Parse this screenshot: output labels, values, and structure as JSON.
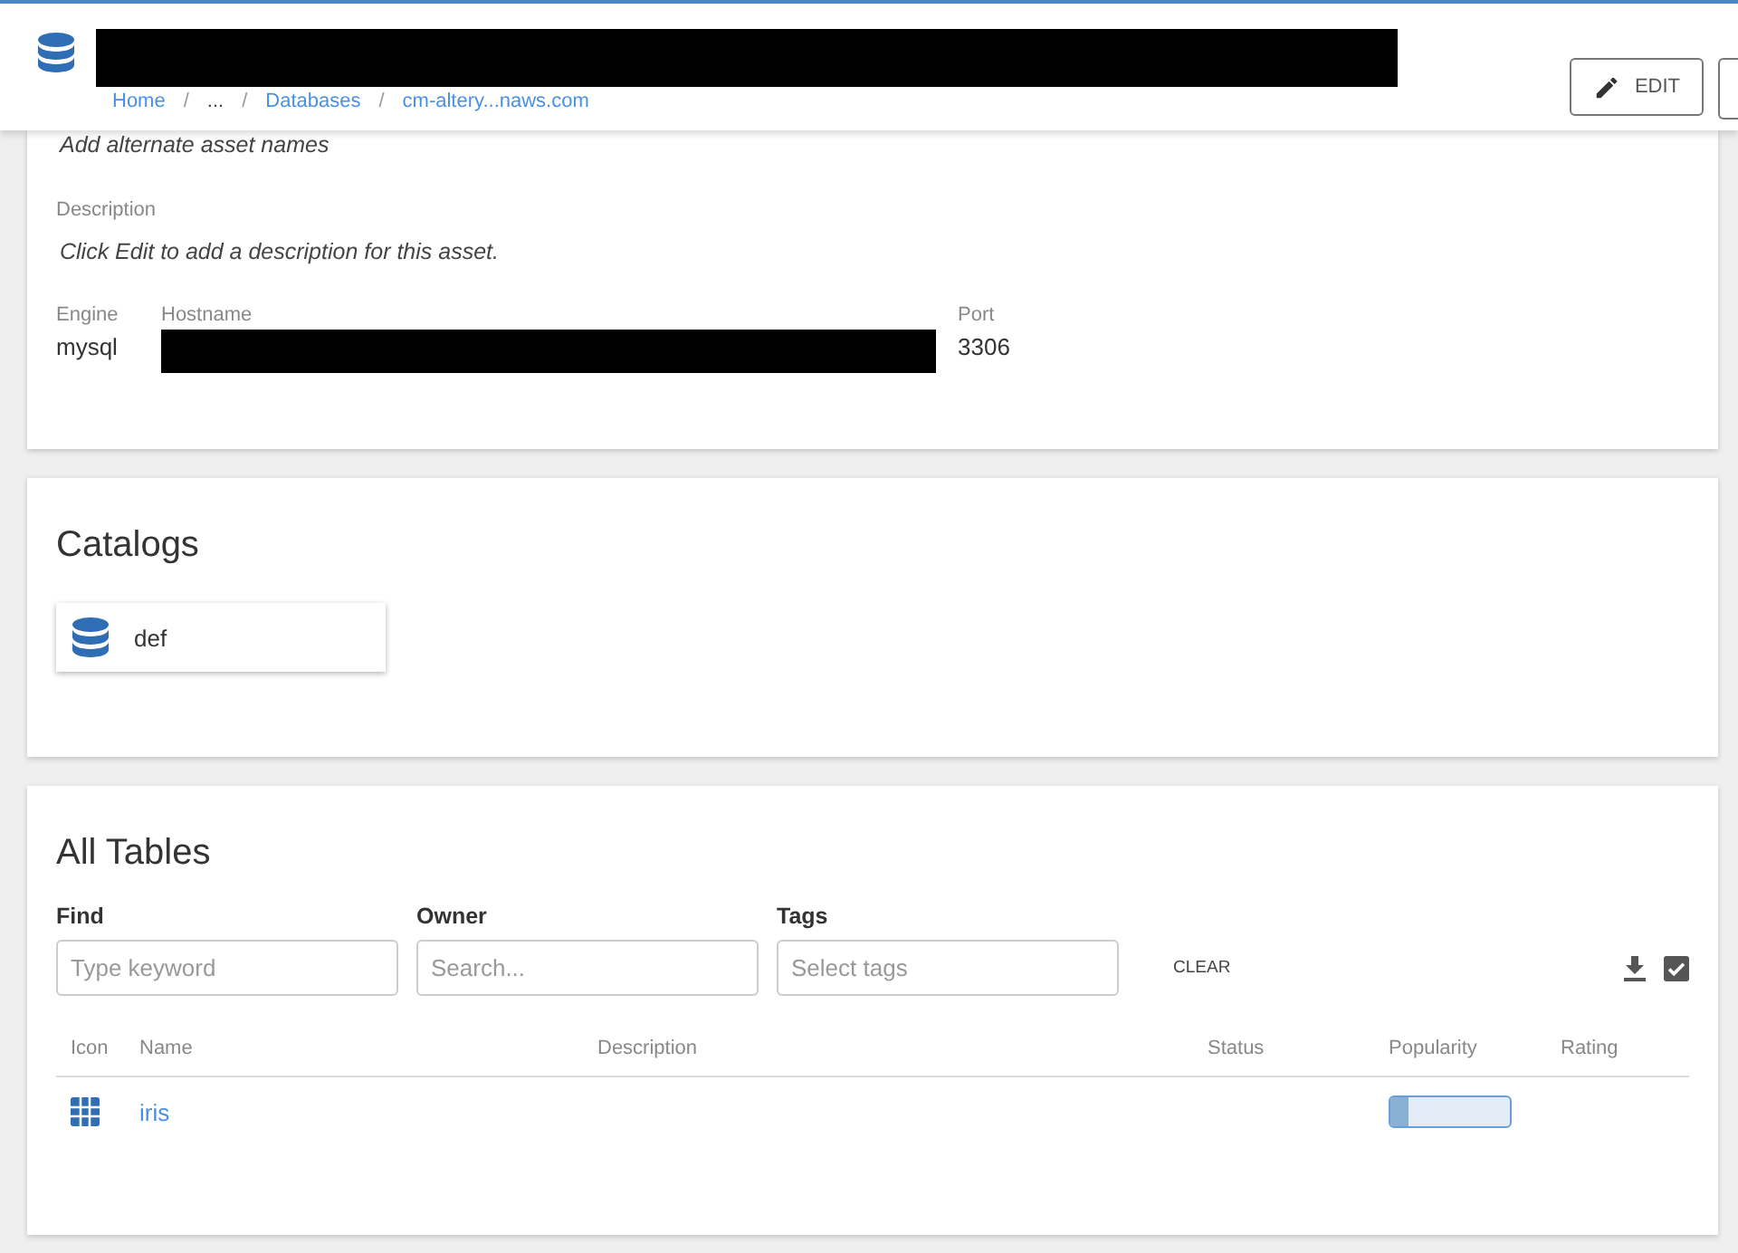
{
  "header": {
    "breadcrumbs": [
      {
        "label": "Home",
        "kind": "link"
      },
      {
        "label": "/",
        "kind": "separator"
      },
      {
        "label": "...",
        "kind": "ellipsis"
      },
      {
        "label": "/",
        "kind": "separator"
      },
      {
        "label": "Databases",
        "kind": "link"
      },
      {
        "label": "/",
        "kind": "separator"
      },
      {
        "label": "cm-altery...naws.com",
        "kind": "link"
      }
    ],
    "edit_button": "EDIT"
  },
  "details": {
    "alternate_names": "Add alternate asset names",
    "description_label": "Description",
    "description": "Click Edit to add a description for this asset.",
    "fields": [
      {
        "label": "Engine",
        "value": "mysql",
        "kind": "text"
      },
      {
        "label": "Hostname",
        "kind": "redacted"
      },
      {
        "label": "Port",
        "value": "3306",
        "kind": "text"
      }
    ]
  },
  "catalogs": {
    "title": "Catalogs",
    "items": [
      "def"
    ]
  },
  "all_tables": {
    "title": "All Tables",
    "filters": [
      {
        "label": "Find",
        "placeholder": "Type keyword"
      },
      {
        "label": "Owner",
        "placeholder": "Search..."
      },
      {
        "label": "Tags",
        "placeholder": "Select tags"
      }
    ],
    "clear_button": "CLEAR",
    "columns": [
      "Icon",
      "Name",
      "Description",
      "Status",
      "Popularity",
      "Rating"
    ],
    "rows": [
      {
        "name": "iris",
        "popularity": {
          "level": 0.15
        }
      }
    ]
  }
}
